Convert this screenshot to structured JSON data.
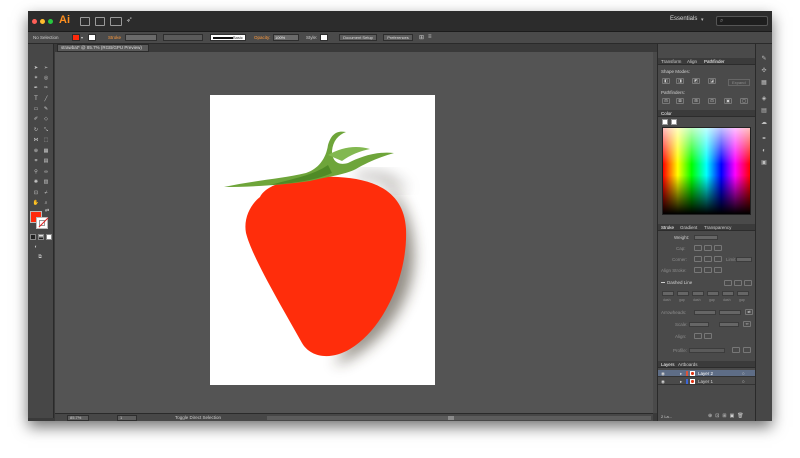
{
  "app": {
    "logo": "Ai",
    "workspace": "Essentials",
    "window_dots": [
      "#ff5f57",
      "#febc2e",
      "#28c840"
    ]
  },
  "control_bar": {
    "selection": "No Selection",
    "stroke_label": "Stroke",
    "brush_label": "Basic",
    "opacity_label": "Opacity:",
    "opacity_value": "100%",
    "style_label": "Style:",
    "doc_setup": "Document Setup",
    "preferences": "Preferences"
  },
  "document": {
    "tab": "strawbat* @ 85.7% (RGB/GPU Preview)"
  },
  "status_bar": {
    "zoom": "85.7%",
    "page": "1",
    "status_text": "Toggle Direct Selection"
  },
  "panels": {
    "top_tabs": [
      "Transform",
      "Align",
      "Pathfinder"
    ],
    "top_active": "Pathfinder",
    "shape_modes": "Shape Modes:",
    "expand": "Expand",
    "pathfinders": "Pathfinders:",
    "color_tab": "Color",
    "stroke_tabs": [
      "Stroke",
      "Gradient",
      "Transparency"
    ],
    "stroke_active": "Stroke",
    "weight_label": "Weight:",
    "cap_label": "Cap:",
    "corner_label": "Corner:",
    "limit_label": "Limit:",
    "align_stroke_label": "Align Stroke:",
    "dashed_line": "Dashed Line",
    "dash_labels": [
      "dash",
      "gap",
      "dash",
      "gap",
      "dash",
      "gap"
    ],
    "arrowheads_label": "Arrowheads:",
    "scale_label": "Scale:",
    "align_label": "Align:",
    "profile_label": "Profile:",
    "layers_tabs": [
      "Layers",
      "Artboards"
    ],
    "layers_active": "Layers",
    "layers": [
      {
        "name": "Layer 2",
        "selected": true
      },
      {
        "name": "Layer 1",
        "selected": false
      }
    ],
    "layers_count": "2 La..."
  },
  "colors": {
    "fill": "#ff2a0c",
    "strawberry": "#ff2d0b",
    "leaves": "#5e9a2c",
    "accent_orange": "#ff9a3c",
    "layer_select": "#5e6d86"
  }
}
